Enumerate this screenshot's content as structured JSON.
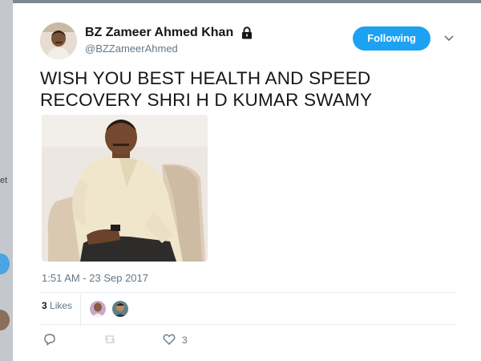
{
  "background": {
    "partial_text": "et"
  },
  "tweet": {
    "author_name": "BZ Zameer Ahmed Khan",
    "handle": "@BZZameerAhmed",
    "follow_label": "Following",
    "text_line1": "WISH YOU BEST HEALTH AND SPEED",
    "text_line2": "RECOVERY SHRI H D KUMAR SWAMY",
    "timestamp": "1:51 AM - 23 Sep 2017",
    "likes_count": "3",
    "likes_label": "Likes",
    "like_action_count": "3"
  },
  "icons": {
    "lock": "lock-icon",
    "chevron": "chevron-down-icon",
    "reply": "reply-icon",
    "retweet": "retweet-icon",
    "like": "heart-icon"
  },
  "colors": {
    "accent": "#1da1f2",
    "secondary_text": "#657786",
    "primary_text": "#14171a",
    "divider": "#e6ecf0"
  }
}
